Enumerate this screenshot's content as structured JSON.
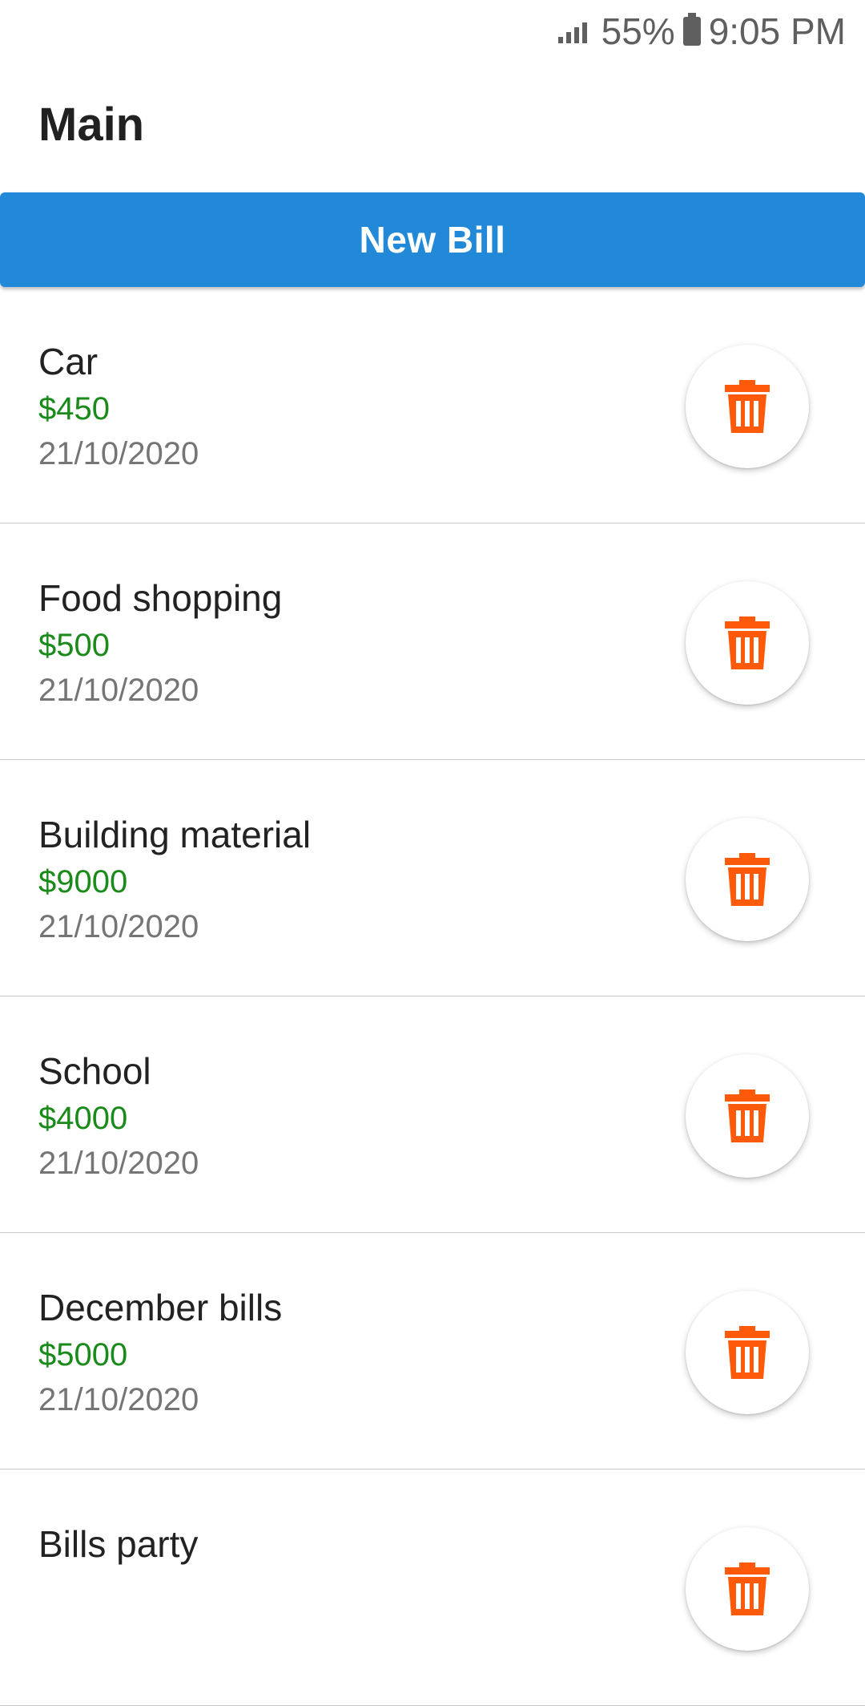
{
  "status_bar": {
    "battery": "55%",
    "time": "9:05 PM"
  },
  "header": {
    "title": "Main"
  },
  "actions": {
    "new_bill_label": "New Bill"
  },
  "colors": {
    "primary": "#2288d8",
    "amount": "#1a8a1a",
    "delete_icon": "#ff5a0a"
  },
  "bills": [
    {
      "name": "Car",
      "amount": "$450",
      "date": "21/10/2020"
    },
    {
      "name": "Food shopping",
      "amount": "$500",
      "date": "21/10/2020"
    },
    {
      "name": "Building material",
      "amount": "$9000",
      "date": "21/10/2020"
    },
    {
      "name": "School",
      "amount": "$4000",
      "date": "21/10/2020"
    },
    {
      "name": "December bills",
      "amount": "$5000",
      "date": "21/10/2020"
    },
    {
      "name": "Bills party",
      "amount": "",
      "date": ""
    }
  ]
}
